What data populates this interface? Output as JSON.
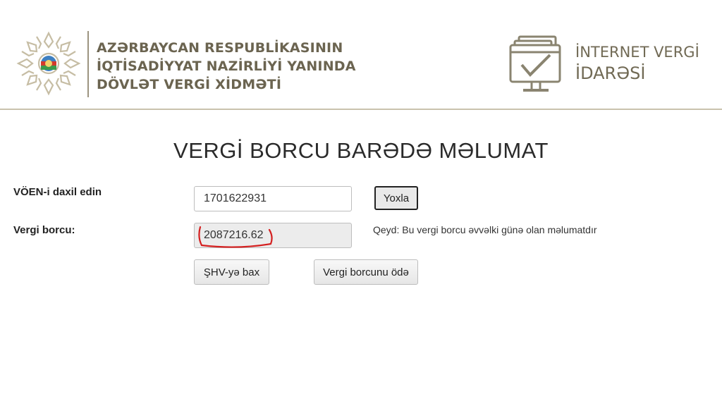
{
  "header": {
    "org_lines": [
      "AZƏRBAYCAN RESPUBLİKASININ",
      "İQTİSADİYYAT NAZİRLİYİ YANINDA",
      "DÖVLƏT VERGİ XİDMƏTİ"
    ],
    "service_line1": "İNTERNET VERGİ",
    "service_line2": "İDARƏSİ",
    "emblem_icon": "emblem-icon",
    "monitor_icon": "monitor-check-icon",
    "brand_color": "#6b6450"
  },
  "page_title": "VERGİ BORCU BARƏDƏ MƏLUMAT",
  "form": {
    "voen_label": "VÖEN-i daxil edin",
    "voen_value": "1701622931",
    "check_button": "Yoxla",
    "debt_label": "Vergi borcu:",
    "debt_value": "2087216.62",
    "note": "Qeyd: Bu vergi borcu əvvəlki günə olan məlumatdır",
    "shv_button": "ŞHV-yə bax",
    "pay_button": "Vergi borcunu ödə",
    "highlight_color": "#d42020"
  }
}
